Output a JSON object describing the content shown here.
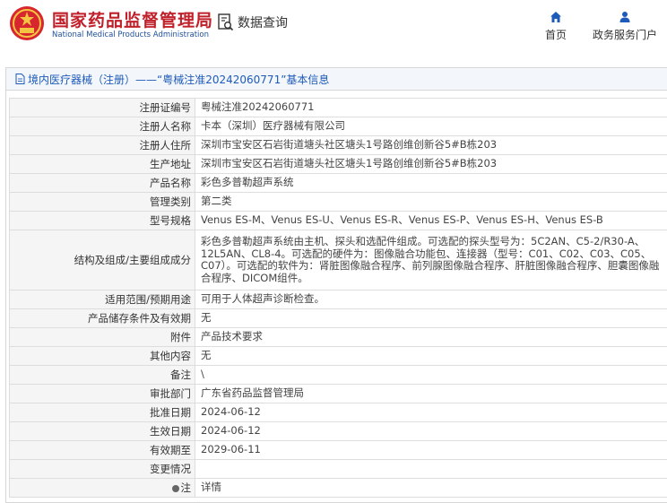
{
  "header": {
    "brand_cn": "国家药品监督管理局",
    "brand_en": "National Medical Products Administration",
    "search_label": "数据查询",
    "nav": [
      {
        "label": "首页",
        "icon": "home-icon"
      },
      {
        "label": "政务服务门户",
        "icon": "user-icon"
      }
    ]
  },
  "panel": {
    "title": "境内医疗器械（注册）——“粤械注准20242060771”基本信息"
  },
  "rows": [
    {
      "label": "注册证编号",
      "value": "粤械注准20242060771"
    },
    {
      "label": "注册人名称",
      "value": "卡本（深圳）医疗器械有限公司"
    },
    {
      "label": "注册人住所",
      "value": "深圳市宝安区石岩街道塘头社区塘头1号路创维创新谷5#B栋203"
    },
    {
      "label": "生产地址",
      "value": "深圳市宝安区石岩街道塘头社区塘头1号路创维创新谷5#B栋203"
    },
    {
      "label": "产品名称",
      "value": "彩色多普勒超声系统"
    },
    {
      "label": "管理类别",
      "value": "第二类"
    },
    {
      "label": "型号规格",
      "value": "Venus ES-M、Venus ES-U、Venus ES-R、Venus ES-P、Venus ES-H、Venus ES-B"
    },
    {
      "label": "结构及组成/主要组成成分",
      "value": "彩色多普勒超声系统由主机、探头和选配件组成。可选配的探头型号为：5C2AN、C5-2/R30-A、12L5AN、CL8-4。可选配的硬件为：图像融合功能包、连接器（型号：C01、C02、C03、C05、C07）。可选配的软件为：肾脏图像融合程序、前列腺图像融合程序、肝脏图像融合程序、胆囊图像融合程序、DICOM组件。"
    },
    {
      "label": "适用范围/预期用途",
      "value": "可用于人体超声诊断检查。"
    },
    {
      "label": "产品储存条件及有效期",
      "value": "无"
    },
    {
      "label": "附件",
      "value": "产品技术要求"
    },
    {
      "label": "其他内容",
      "value": "无"
    },
    {
      "label": "备注",
      "value": "\\"
    },
    {
      "label": "审批部门",
      "value": "广东省药品监督管理局"
    },
    {
      "label": "批准日期",
      "value": "2024-06-12"
    },
    {
      "label": "生效日期",
      "value": "2024-06-12"
    },
    {
      "label": "有效期至",
      "value": "2029-06-11"
    },
    {
      "label": "变更情况",
      "value": ""
    },
    {
      "label": "注",
      "value": "详情"
    }
  ]
}
